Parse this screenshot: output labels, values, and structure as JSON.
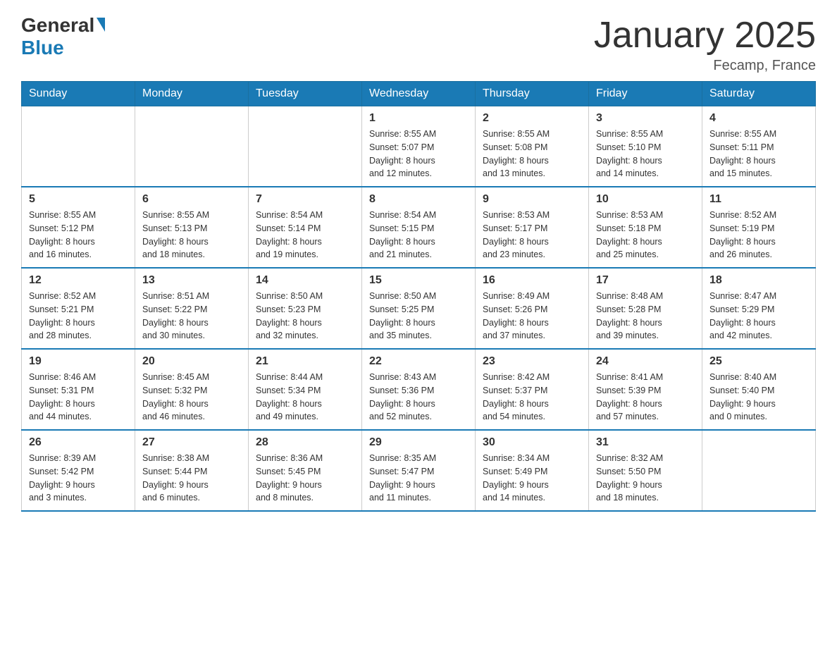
{
  "header": {
    "logo_general": "General",
    "logo_blue": "Blue",
    "title": "January 2025",
    "location": "Fecamp, France"
  },
  "weekdays": [
    "Sunday",
    "Monday",
    "Tuesday",
    "Wednesday",
    "Thursday",
    "Friday",
    "Saturday"
  ],
  "weeks": [
    [
      {
        "day": "",
        "info": ""
      },
      {
        "day": "",
        "info": ""
      },
      {
        "day": "",
        "info": ""
      },
      {
        "day": "1",
        "info": "Sunrise: 8:55 AM\nSunset: 5:07 PM\nDaylight: 8 hours\nand 12 minutes."
      },
      {
        "day": "2",
        "info": "Sunrise: 8:55 AM\nSunset: 5:08 PM\nDaylight: 8 hours\nand 13 minutes."
      },
      {
        "day": "3",
        "info": "Sunrise: 8:55 AM\nSunset: 5:10 PM\nDaylight: 8 hours\nand 14 minutes."
      },
      {
        "day": "4",
        "info": "Sunrise: 8:55 AM\nSunset: 5:11 PM\nDaylight: 8 hours\nand 15 minutes."
      }
    ],
    [
      {
        "day": "5",
        "info": "Sunrise: 8:55 AM\nSunset: 5:12 PM\nDaylight: 8 hours\nand 16 minutes."
      },
      {
        "day": "6",
        "info": "Sunrise: 8:55 AM\nSunset: 5:13 PM\nDaylight: 8 hours\nand 18 minutes."
      },
      {
        "day": "7",
        "info": "Sunrise: 8:54 AM\nSunset: 5:14 PM\nDaylight: 8 hours\nand 19 minutes."
      },
      {
        "day": "8",
        "info": "Sunrise: 8:54 AM\nSunset: 5:15 PM\nDaylight: 8 hours\nand 21 minutes."
      },
      {
        "day": "9",
        "info": "Sunrise: 8:53 AM\nSunset: 5:17 PM\nDaylight: 8 hours\nand 23 minutes."
      },
      {
        "day": "10",
        "info": "Sunrise: 8:53 AM\nSunset: 5:18 PM\nDaylight: 8 hours\nand 25 minutes."
      },
      {
        "day": "11",
        "info": "Sunrise: 8:52 AM\nSunset: 5:19 PM\nDaylight: 8 hours\nand 26 minutes."
      }
    ],
    [
      {
        "day": "12",
        "info": "Sunrise: 8:52 AM\nSunset: 5:21 PM\nDaylight: 8 hours\nand 28 minutes."
      },
      {
        "day": "13",
        "info": "Sunrise: 8:51 AM\nSunset: 5:22 PM\nDaylight: 8 hours\nand 30 minutes."
      },
      {
        "day": "14",
        "info": "Sunrise: 8:50 AM\nSunset: 5:23 PM\nDaylight: 8 hours\nand 32 minutes."
      },
      {
        "day": "15",
        "info": "Sunrise: 8:50 AM\nSunset: 5:25 PM\nDaylight: 8 hours\nand 35 minutes."
      },
      {
        "day": "16",
        "info": "Sunrise: 8:49 AM\nSunset: 5:26 PM\nDaylight: 8 hours\nand 37 minutes."
      },
      {
        "day": "17",
        "info": "Sunrise: 8:48 AM\nSunset: 5:28 PM\nDaylight: 8 hours\nand 39 minutes."
      },
      {
        "day": "18",
        "info": "Sunrise: 8:47 AM\nSunset: 5:29 PM\nDaylight: 8 hours\nand 42 minutes."
      }
    ],
    [
      {
        "day": "19",
        "info": "Sunrise: 8:46 AM\nSunset: 5:31 PM\nDaylight: 8 hours\nand 44 minutes."
      },
      {
        "day": "20",
        "info": "Sunrise: 8:45 AM\nSunset: 5:32 PM\nDaylight: 8 hours\nand 46 minutes."
      },
      {
        "day": "21",
        "info": "Sunrise: 8:44 AM\nSunset: 5:34 PM\nDaylight: 8 hours\nand 49 minutes."
      },
      {
        "day": "22",
        "info": "Sunrise: 8:43 AM\nSunset: 5:36 PM\nDaylight: 8 hours\nand 52 minutes."
      },
      {
        "day": "23",
        "info": "Sunrise: 8:42 AM\nSunset: 5:37 PM\nDaylight: 8 hours\nand 54 minutes."
      },
      {
        "day": "24",
        "info": "Sunrise: 8:41 AM\nSunset: 5:39 PM\nDaylight: 8 hours\nand 57 minutes."
      },
      {
        "day": "25",
        "info": "Sunrise: 8:40 AM\nSunset: 5:40 PM\nDaylight: 9 hours\nand 0 minutes."
      }
    ],
    [
      {
        "day": "26",
        "info": "Sunrise: 8:39 AM\nSunset: 5:42 PM\nDaylight: 9 hours\nand 3 minutes."
      },
      {
        "day": "27",
        "info": "Sunrise: 8:38 AM\nSunset: 5:44 PM\nDaylight: 9 hours\nand 6 minutes."
      },
      {
        "day": "28",
        "info": "Sunrise: 8:36 AM\nSunset: 5:45 PM\nDaylight: 9 hours\nand 8 minutes."
      },
      {
        "day": "29",
        "info": "Sunrise: 8:35 AM\nSunset: 5:47 PM\nDaylight: 9 hours\nand 11 minutes."
      },
      {
        "day": "30",
        "info": "Sunrise: 8:34 AM\nSunset: 5:49 PM\nDaylight: 9 hours\nand 14 minutes."
      },
      {
        "day": "31",
        "info": "Sunrise: 8:32 AM\nSunset: 5:50 PM\nDaylight: 9 hours\nand 18 minutes."
      },
      {
        "day": "",
        "info": ""
      }
    ]
  ]
}
